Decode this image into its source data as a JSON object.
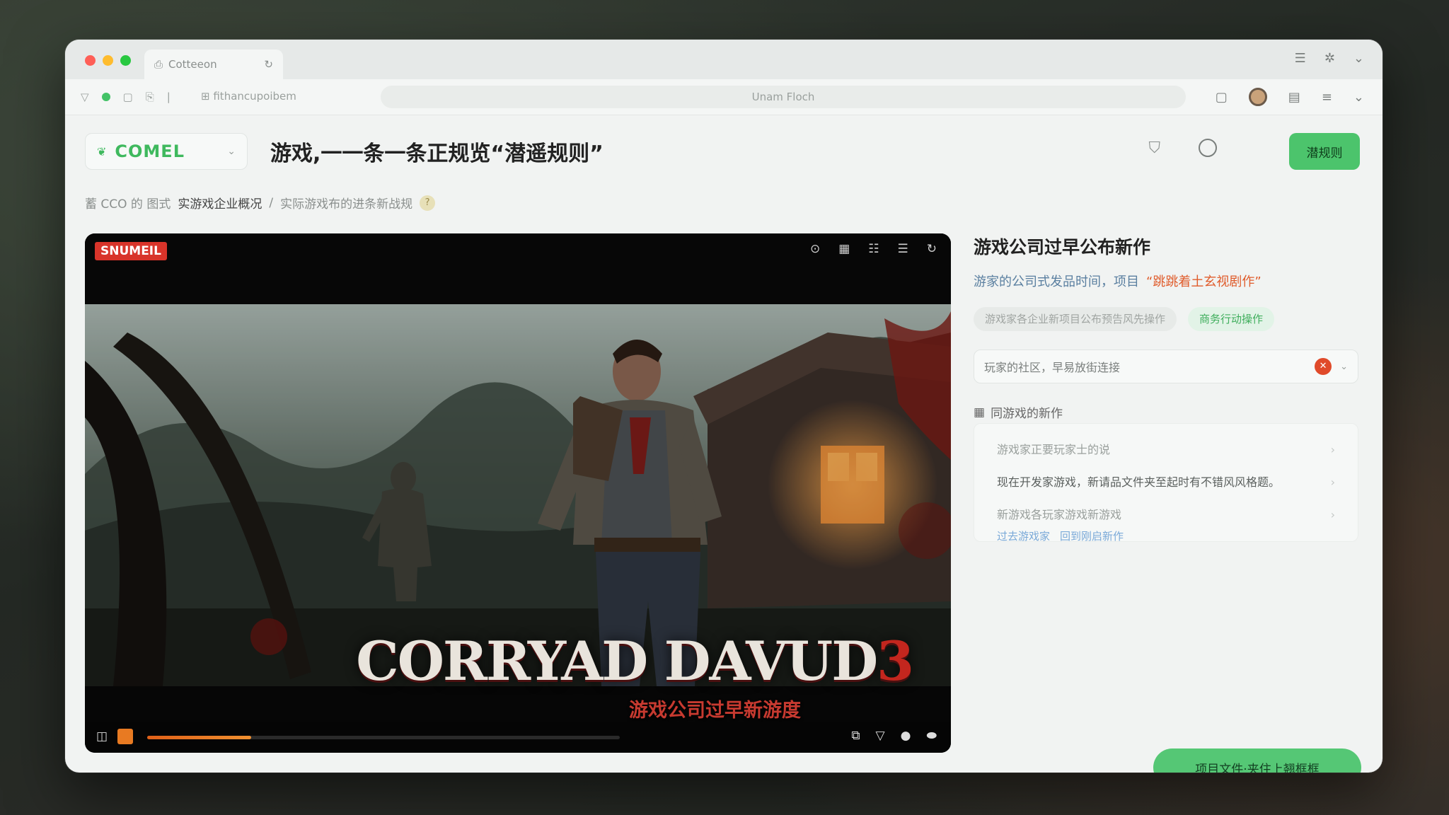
{
  "browser": {
    "tab_title": "Cotteeon",
    "url_prefix": "fithancupoibem",
    "url": "Unam Floch"
  },
  "header": {
    "brand": "COMEL",
    "title": "游戏,一一条一条正规览“潜遥规则”",
    "primary_button": "潜规则"
  },
  "breadcrumb": {
    "part1_prefix": "蓄 CCO 的 图式",
    "part1_strong": "实游戏企业概况",
    "separator": "/",
    "part2": "实际游戏布的进条新战规"
  },
  "player": {
    "logo": "SNUMEIL",
    "game_title_text": "CORRYAD DAVUD",
    "game_title_number": "3",
    "game_subtitle": "游戏公司过早新游度",
    "progress": 0.22
  },
  "side": {
    "title": "游戏公司过早公布新作",
    "subtitle": "游家的公司式发品时间，项目",
    "subtitle_warn": "“跳跳着土玄视剧作”",
    "pills": [
      "游戏家各企业新项目公布预告风先操作",
      "商务行动操作"
    ],
    "select_value": "玩家的社区，早易放街连接",
    "section_label": "同游戏的新作",
    "list": [
      "游戏家正要玩家士的说",
      "现在开发家游戏，新请品文件夹至起时有不错风风格题。",
      "新游戏各玩家游戏新游戏"
    ],
    "links": [
      "过去游戏家",
      "回到刚启新作"
    ],
    "cta": "项目文件·夹住上翘框框"
  },
  "colors": {
    "accent_green": "#4cc46c",
    "warn_orange": "#e05c2c",
    "link_blue": "#5a7fa0",
    "title_red": "#c3261e"
  }
}
